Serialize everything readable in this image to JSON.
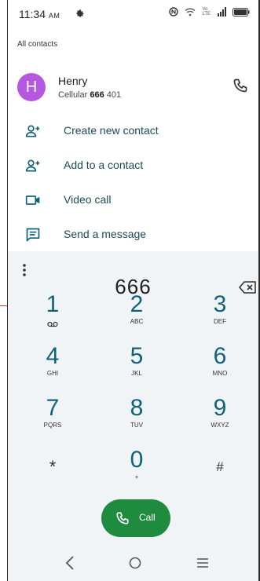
{
  "status_bar": {
    "time": "11:34",
    "ampm": "AM",
    "icons": [
      "gear-icon",
      "nfc-icon",
      "wifi-icon",
      "lte-icon",
      "signal-icon",
      "battery-icon"
    ],
    "lte_label_top": "Vo",
    "lte_label_bottom": "LTE"
  },
  "all_contacts_label": "All contacts",
  "contact": {
    "avatar_letter": "H",
    "avatar_color": "#b657e0",
    "name": "Henry",
    "type": "Cellular",
    "number_match": "666",
    "number_rest": " 401"
  },
  "actions": [
    {
      "label": "Create new contact",
      "icon": "person-add-icon"
    },
    {
      "label": "Add to a contact",
      "icon": "person-add-icon"
    },
    {
      "label": "Video call",
      "icon": "video-call-icon"
    },
    {
      "label": "Send a message",
      "icon": "message-icon"
    }
  ],
  "dialer": {
    "number": "666",
    "keys": [
      {
        "digit": "1",
        "letters": ""
      },
      {
        "digit": "2",
        "letters": "ABC"
      },
      {
        "digit": "3",
        "letters": "DEF"
      },
      {
        "digit": "4",
        "letters": "GHI"
      },
      {
        "digit": "5",
        "letters": "JKL"
      },
      {
        "digit": "6",
        "letters": "MNO"
      },
      {
        "digit": "7",
        "letters": "PQRS"
      },
      {
        "digit": "8",
        "letters": "TUV"
      },
      {
        "digit": "9",
        "letters": "WXYZ"
      },
      {
        "digit": "*",
        "letters": ""
      },
      {
        "digit": "0",
        "letters": "+"
      },
      {
        "digit": "#",
        "letters": ""
      }
    ],
    "call_label": "Call",
    "accent_color": "#12617a",
    "call_color": "#1f8b3f"
  },
  "nav": {
    "icons": [
      "back-icon",
      "home-icon",
      "recents-icon"
    ]
  }
}
